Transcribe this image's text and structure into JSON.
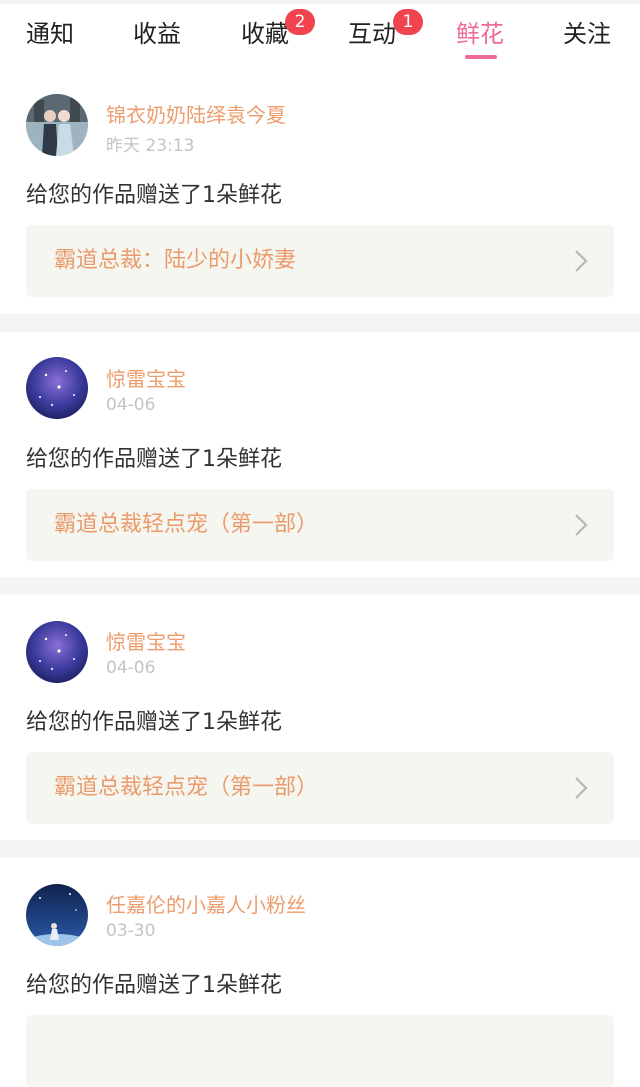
{
  "tabs": [
    {
      "label": "通知"
    },
    {
      "label": "收益"
    },
    {
      "label": "收藏",
      "badge": "2"
    },
    {
      "label": "互动",
      "badge": "1"
    },
    {
      "label": "鲜花",
      "active": true
    },
    {
      "label": "关注"
    }
  ],
  "colors": {
    "accent": "#f06a98",
    "username": "#ec9d6e",
    "badge": "#f0444f"
  },
  "notifications": [
    {
      "user": "锦衣奶奶陆绎袁今夏",
      "time": "昨天 23:13",
      "message": "给您的作品赠送了1朵鲜花",
      "work": "霸道总裁：陆少的小娇妻"
    },
    {
      "user": "惊雷宝宝",
      "time": "04-06",
      "message": "给您的作品赠送了1朵鲜花",
      "work": "霸道总裁轻点宠（第一部）"
    },
    {
      "user": "惊雷宝宝",
      "time": "04-06",
      "message": "给您的作品赠送了1朵鲜花",
      "work": "霸道总裁轻点宠（第一部）"
    },
    {
      "user": "任嘉伦的小嘉人小粉丝",
      "time": "03-30",
      "message": "给您的作品赠送了1朵鲜花",
      "work": ""
    }
  ]
}
